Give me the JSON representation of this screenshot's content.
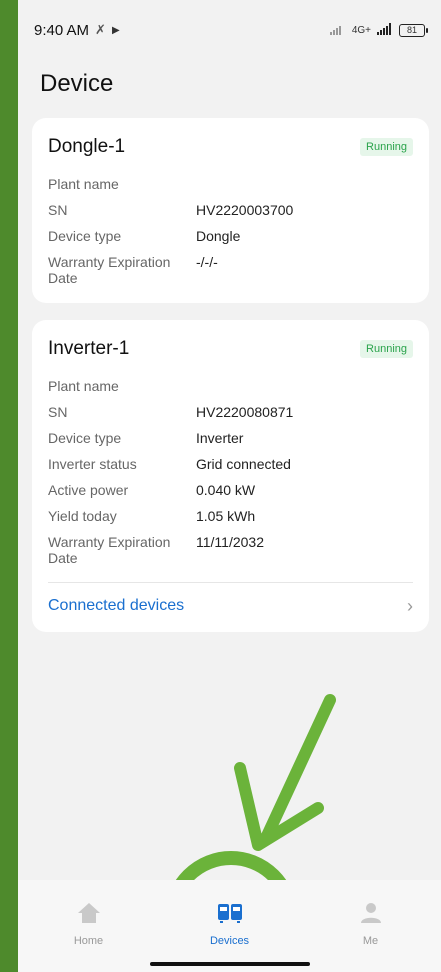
{
  "status_bar": {
    "time": "9:40 AM",
    "network": "4G+",
    "battery": "81"
  },
  "page_title": "Device",
  "cards": [
    {
      "title": "Dongle-1",
      "status": "Running",
      "rows": [
        {
          "label": "Plant name",
          "value": ""
        },
        {
          "label": "SN",
          "value": "HV2220003700"
        },
        {
          "label": "Device type",
          "value": "Dongle"
        },
        {
          "label": "Warranty Expiration Date",
          "value": "-/-/-"
        }
      ]
    },
    {
      "title": "Inverter-1",
      "status": "Running",
      "rows": [
        {
          "label": "Plant name",
          "value": ""
        },
        {
          "label": "SN",
          "value": "HV2220080871"
        },
        {
          "label": "Device type",
          "value": "Inverter"
        },
        {
          "label": "Inverter status",
          "value": "Grid connected"
        },
        {
          "label": "Active power",
          "value": "0.040 kW"
        },
        {
          "label": "Yield today",
          "value": "1.05 kWh"
        },
        {
          "label": "Warranty Expiration Date",
          "value": "11/11/2032"
        }
      ],
      "connected_devices_label": "Connected devices"
    }
  ],
  "tabs": [
    {
      "label": "Home",
      "icon": "home-icon",
      "active": false
    },
    {
      "label": "Devices",
      "icon": "devices-icon",
      "active": true
    },
    {
      "label": "Me",
      "icon": "user-icon",
      "active": false
    }
  ],
  "colors": {
    "accent": "#1a6fcf",
    "running_text": "#2aa34b",
    "running_bg": "#e6f6ea",
    "annotation_green": "#6bb33a",
    "frame_green": "#4e8a2c"
  }
}
